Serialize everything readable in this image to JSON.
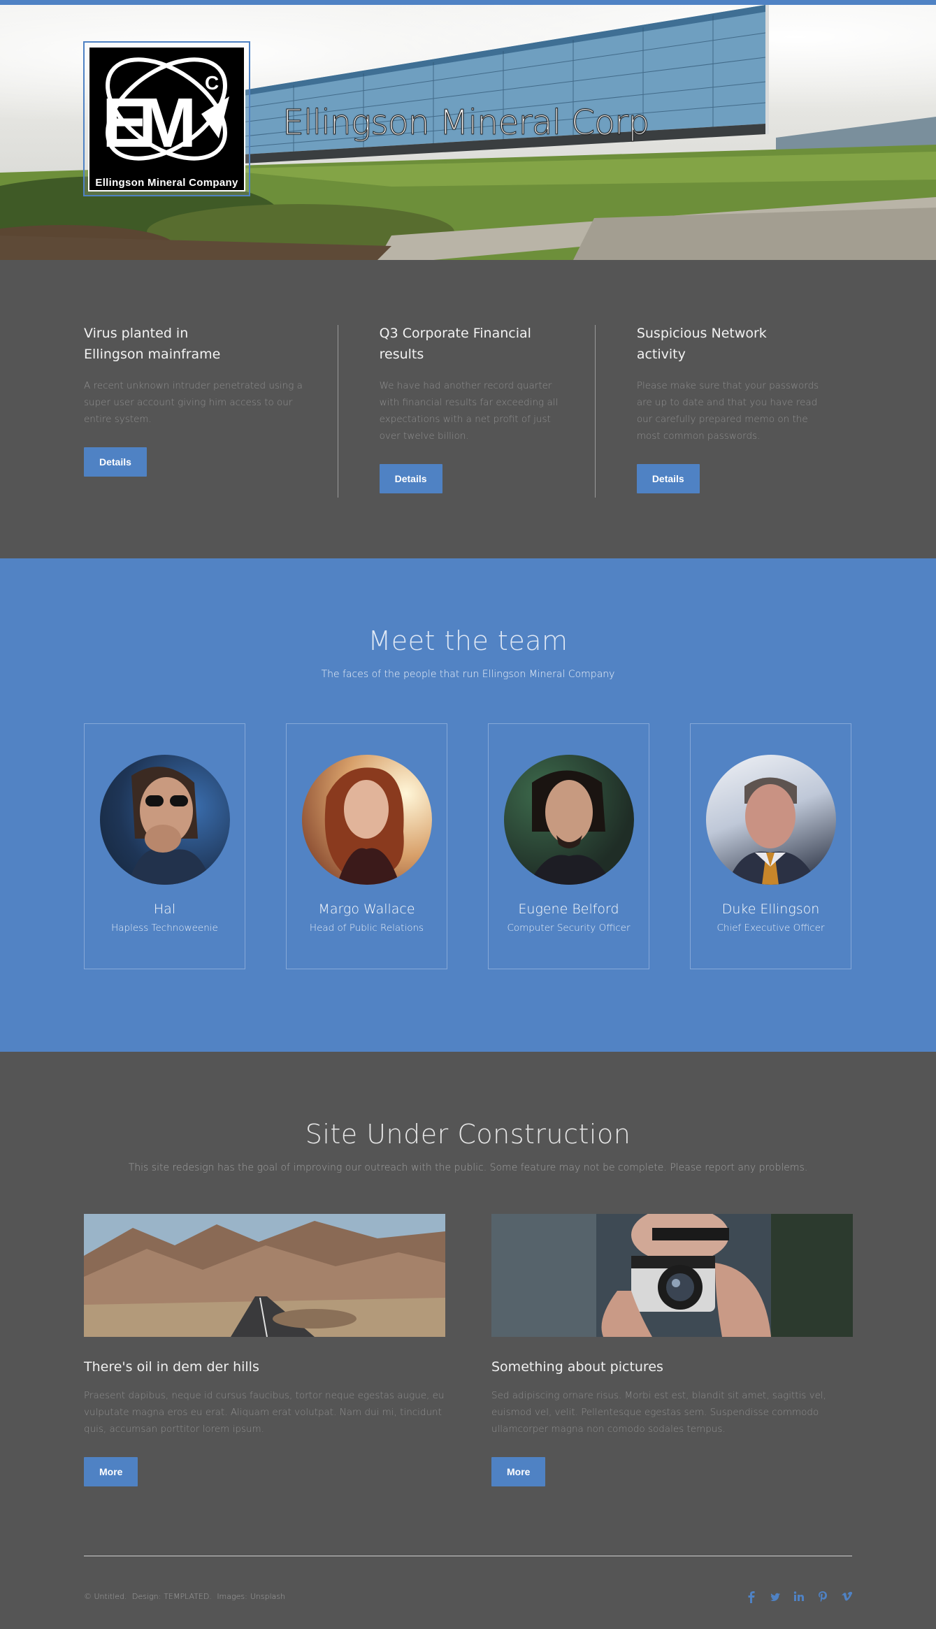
{
  "hero": {
    "title": "Ellingson Mineral Corp",
    "logo_letters": "EMC",
    "logo_caption": "Ellingson Mineral Company"
  },
  "news": [
    {
      "title": "Virus planted in Ellingson mainframe",
      "text": "A recent unknown intruder penetrated using a super user account giving him access to our entire system.",
      "button": "Details"
    },
    {
      "title": "Q3 Corporate Financial results",
      "text": "We have had another record quarter with financial results far exceeding all expectations with a net profit of just over twelve billion.",
      "button": "Details"
    },
    {
      "title": "Suspicious Network activity",
      "text": "Please make sure that your passwords are up to date and that you have read our carefully prepared memo on the most common passwords.",
      "button": "Details"
    }
  ],
  "team": {
    "title": "Meet the team",
    "subtitle": "The faces of the people that run Ellingson Mineral Company",
    "members": [
      {
        "name": "Hal",
        "role": "Hapless Technoweenie"
      },
      {
        "name": "Margo Wallace",
        "role": "Head of Public Relations"
      },
      {
        "name": "Eugene Belford",
        "role": "Computer Security Officer"
      },
      {
        "name": "Duke Ellingson",
        "role": "Chief Executive Officer"
      }
    ]
  },
  "construction": {
    "title": "Site Under Construction",
    "subtitle": "This site redesign has the goal of improving our outreach with the public. Some feature may not be complete. Please report any problems.",
    "posts": [
      {
        "title": "There's oil in dem der hills",
        "text": "Praesent dapibus, neque id cursus faucibus, tortor neque egestas augue, eu vulputate magna eros eu erat. Aliquam erat volutpat. Nam dui mi, tincidunt quis, accumsan porttitor lorem ipsum.",
        "button": "More"
      },
      {
        "title": "Something about pictures",
        "text": "Sed adipiscing ornare risus. Morbi est est, blandit sit amet, sagittis vel, euismod vel, velit. Pellentesque egestas sem. Suspendisse commodo ullamcorper magna non comodo sodales tempus.",
        "button": "More"
      }
    ]
  },
  "footer": {
    "copyright": "© Untitled.",
    "design_label": "Design:",
    "design_value": "TEMPLATED.",
    "images_label": "Images:",
    "images_value": "Unsplash",
    "social": [
      "facebook-icon",
      "twitter-icon",
      "linkedin-icon",
      "pinterest-icon",
      "vimeo-icon"
    ]
  },
  "colors": {
    "accent": "#4f82c4",
    "background": "#555555",
    "team_bg": "#5283c4"
  }
}
